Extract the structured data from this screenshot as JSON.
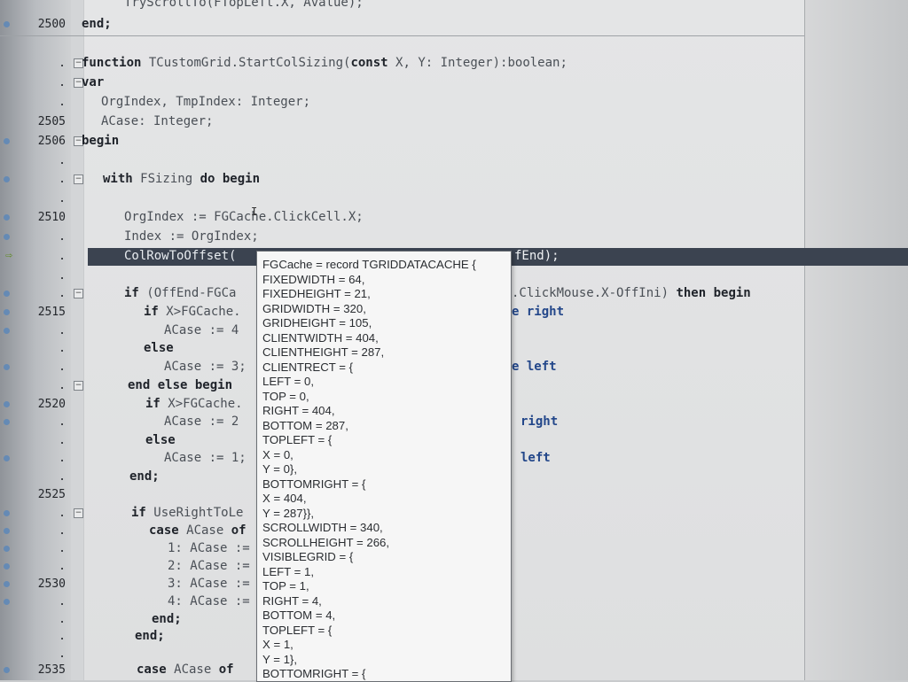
{
  "gutter": {
    "line_numbers": {
      "l2500": "2500",
      "l2505": "2505",
      "l2506": "2506",
      "l2510": "2510",
      "l2515": "2515",
      "l2520": "2520",
      "l2525": "2525",
      "l2530": "2530",
      "l2535": "2535"
    },
    "dot": "."
  },
  "code": {
    "line0": "TryScrollTo(FTopLeft.X, Avalue);",
    "line1_kw": "end;",
    "line2_kw1": "function",
    "line2_rest": " TCustomGrid.StartColSizing(",
    "line2_kw2": "const",
    "line2_rest2": " X, Y: Integer):boolean;",
    "line3_kw": "var",
    "line4": "OrgIndex, TmpIndex: Integer;",
    "line5": "ACase: Integer;",
    "line6_kw": "begin",
    "line7_kw1": "with",
    "line7_mid": " FSizing ",
    "line7_kw2": "do begin",
    "line8": "OrgIndex := FGCache.ClickCell.X;",
    "line9": "Index := OrgIndex;",
    "line10": "ColRowToOffset(",
    "line10_tail": "fEnd);",
    "line11_kw": "if",
    "line11_rest": " (OffEnd-FGCa",
    "line11_right": ".ClickMouse.X-OffIni)",
    "line11_right_kw": " then begin",
    "line12_kw": "if",
    "line12_rest": " X>FGCache.",
    "line12_right": "e right",
    "line13": "ACase := 4",
    "line14_kw": "else",
    "line15": "ACase := 3;",
    "line15_right": "e left",
    "line16_kw": "end else begin",
    "line17_kw": "if",
    "line17_rest": " X>FGCache.",
    "line18": "ACase := 2",
    "line18_right": "right",
    "line19_kw": "else",
    "line20": "ACase := 1;",
    "line20_right": "left",
    "line21_kw": "end;",
    "line22_kw": "if",
    "line22_rest": " UseRightToLe",
    "line23_kw1": "case",
    "line23_rest": " ACase ",
    "line23_kw2": "of",
    "line24": "1: ACase :=",
    "line25": "2: ACase :=",
    "line26": "3: ACase :=",
    "line27": "4: ACase :=",
    "line28_kw": "end;",
    "line29_kw": "end;",
    "line30_kw1": "case",
    "line30_rest": " ACase ",
    "line30_kw2": "of"
  },
  "tooltip": {
    "lines": [
      "FGCache = record TGRIDDATACACHE {",
      "FIXEDWIDTH = 64,",
      "FIXEDHEIGHT = 21,",
      "GRIDWIDTH = 320,",
      "GRIDHEIGHT = 105,",
      "CLIENTWIDTH = 404,",
      "CLIENTHEIGHT = 287,",
      "CLIENTRECT = {",
      "LEFT = 0,",
      "TOP = 0,",
      "RIGHT = 404,",
      "BOTTOM = 287,",
      "TOPLEFT = {",
      "X = 0,",
      "Y = 0},",
      "BOTTOMRIGHT = {",
      "X = 404,",
      "Y = 287}},",
      "SCROLLWIDTH = 340,",
      "SCROLLHEIGHT = 266,",
      "VISIBLEGRID = {",
      "LEFT = 1,",
      "TOP = 1,",
      "RIGHT = 4,",
      "BOTTOM = 4,",
      "TOPLEFT = {",
      "X = 1,",
      "Y = 1},",
      "BOTTOMRIGHT = {"
    ]
  },
  "colors": {
    "highlight_bar": "#3b4350",
    "keyword": "#1f232a",
    "breakpoint_dot": "#5c87b8"
  },
  "icons": {
    "fold": "fold-box-icon",
    "execution_point": "execution-arrow-icon",
    "breakpoint": "breakpoint-dot-icon"
  }
}
